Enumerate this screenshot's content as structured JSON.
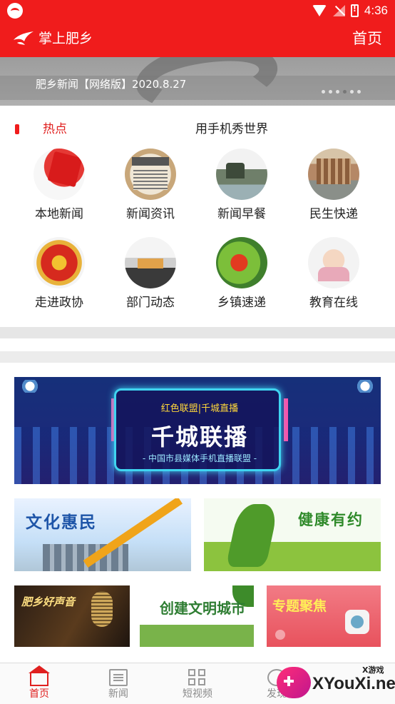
{
  "status_bar": {
    "time": "4:36",
    "icons": [
      "app-notification-icon",
      "wifi-icon",
      "no-signal-icon",
      "battery-alert-icon"
    ]
  },
  "app_bar": {
    "title": "掌上肥乡",
    "home_link": "首页",
    "logo_icon": "bird-logo-icon"
  },
  "banner": {
    "caption": "肥乡新闻【网络版】2020.8.27",
    "dot_count": 6,
    "active_dot": 4
  },
  "hot": {
    "label": "热点",
    "headline": "用手机秀世界"
  },
  "grid": {
    "items": [
      {
        "label": "本地新闻",
        "icon": "jinri-toutiao-icon"
      },
      {
        "label": "新闻资讯",
        "icon": "newspaper-icon"
      },
      {
        "label": "新闻早餐",
        "icon": "pavilion-photo-icon"
      },
      {
        "label": "民生快递",
        "icon": "apartments-photo-icon"
      },
      {
        "label": "走进政协",
        "icon": "national-emblem-icon"
      },
      {
        "label": "部门动态",
        "icon": "office-photo-icon"
      },
      {
        "label": "乡镇速递",
        "icon": "cherries-photo-icon"
      },
      {
        "label": "教育在线",
        "icon": "mother-child-photo-icon"
      }
    ]
  },
  "promo": {
    "top_line": "红色联盟|千城直播",
    "main": "千城联播",
    "sub": "- 中国市县媒体手机直播联盟 -"
  },
  "tiles": {
    "wenhua": "文化惠民",
    "jiankang": "健康有约",
    "voice": "肥乡好声音",
    "civ": "创建文明城市",
    "topic": "专题聚焦"
  },
  "bottom_nav": {
    "items": [
      {
        "label": "首页",
        "icon": "home-icon",
        "active": true
      },
      {
        "label": "新闻",
        "icon": "news-icon",
        "active": false
      },
      {
        "label": "短视频",
        "icon": "grid-icon",
        "active": false
      },
      {
        "label": "发现",
        "icon": "discover-icon",
        "active": false
      }
    ]
  },
  "watermark": {
    "small": "X游戏",
    "big": "XYouXi.net"
  },
  "colors": {
    "brand_red": "#f01c1c",
    "active_red": "#e0201f",
    "nav_gray": "#8a8a8a"
  }
}
